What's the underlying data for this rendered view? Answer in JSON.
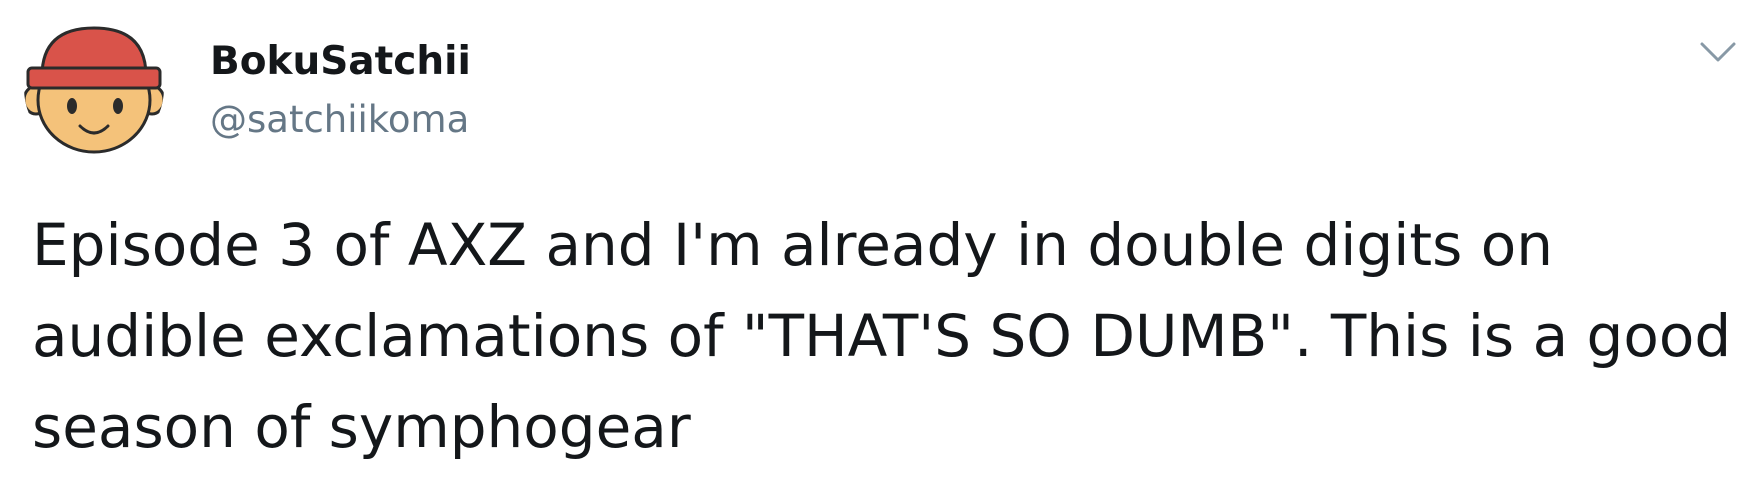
{
  "tweet": {
    "author": {
      "display_name": "BokuSatchii",
      "handle": "@satchiikoma",
      "avatar": {
        "icon": "cartoon-face-red-hat-avatar",
        "hat_color": "#d9534a",
        "skin_color": "#f4c27a"
      }
    },
    "menu_icon": "chevron-down-icon",
    "text": "Episode 3 of AXZ and I'm already in double digits on audible exclamations of \"THAT'S SO DUMB\". This is a good season of symphogear"
  },
  "colors": {
    "text": "#14171a",
    "secondary_text": "#657786",
    "caret": "#8899a6",
    "background": "#ffffff"
  }
}
